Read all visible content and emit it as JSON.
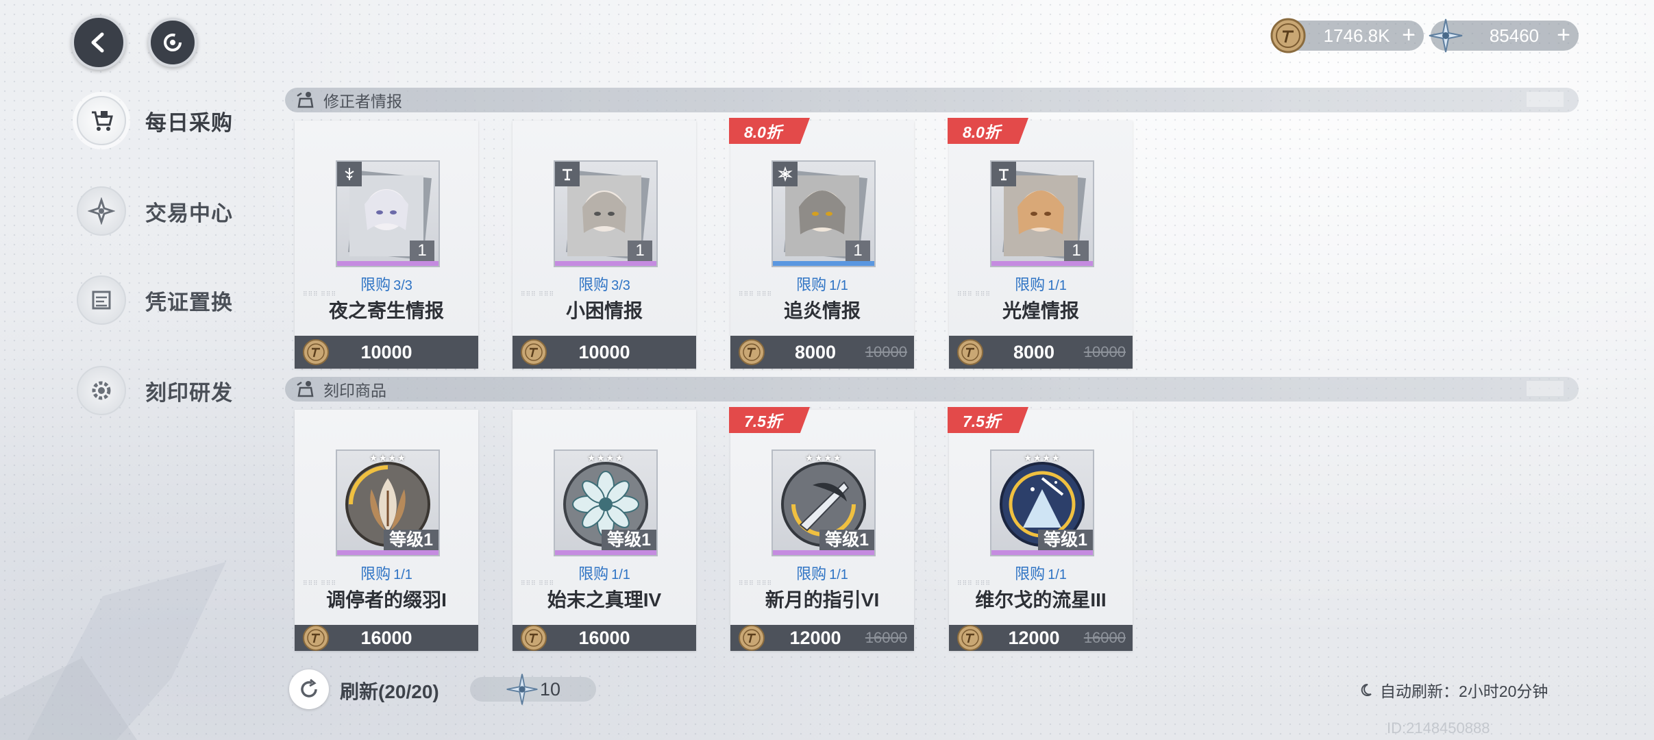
{
  "currency": [
    {
      "icon": "gold-coin-icon",
      "value": "1746.8K",
      "plus": "+"
    },
    {
      "icon": "star-crystal-icon",
      "value": "85460",
      "plus": "+"
    }
  ],
  "sidebar": {
    "items": [
      {
        "label": "每日采购",
        "icon": "cart-icon",
        "active": true
      },
      {
        "label": "交易中心",
        "icon": "star-badge-icon",
        "active": false
      },
      {
        "label": "凭证置换",
        "icon": "exchange-icon",
        "active": false
      },
      {
        "label": "刻印研发",
        "icon": "gear-icon",
        "active": false
      }
    ]
  },
  "sections": [
    {
      "title": "修正者情报",
      "items": [
        {
          "discount": "",
          "limit_label": "限购",
          "limit": "3/3",
          "name": "夜之寄生情报",
          "qty": "1",
          "price": "10000",
          "old_price": "",
          "rarity_color": "#c58be0"
        },
        {
          "discount": "",
          "limit_label": "限购",
          "limit": "3/3",
          "name": "小困情报",
          "qty": "1",
          "price": "10000",
          "old_price": "",
          "rarity_color": "#c58be0"
        },
        {
          "discount": "8.0折",
          "limit_label": "限购",
          "limit": "1/1",
          "name": "追炎情报",
          "qty": "1",
          "price": "8000",
          "old_price": "10000",
          "rarity_color": "#5a97e0"
        },
        {
          "discount": "8.0折",
          "limit_label": "限购",
          "limit": "1/1",
          "name": "光煌情报",
          "qty": "1",
          "price": "8000",
          "old_price": "10000",
          "rarity_color": "#c58be0"
        }
      ]
    },
    {
      "title": "刻印商品",
      "items": [
        {
          "discount": "",
          "limit_label": "限购",
          "limit": "1/1",
          "name": "调停者的缀羽I",
          "level": "等级1",
          "stars": "★★★★",
          "price": "16000",
          "old_price": "",
          "rarity_color": "#c58be0"
        },
        {
          "discount": "",
          "limit_label": "限购",
          "limit": "1/1",
          "name": "始末之真理IV",
          "level": "等级1",
          "stars": "★★★★",
          "price": "16000",
          "old_price": "",
          "rarity_color": "#c58be0"
        },
        {
          "discount": "7.5折",
          "limit_label": "限购",
          "limit": "1/1",
          "name": "新月的指引VI",
          "level": "等级1",
          "stars": "★★★★",
          "price": "12000",
          "old_price": "16000",
          "rarity_color": "#c58be0"
        },
        {
          "discount": "7.5折",
          "limit_label": "限购",
          "limit": "1/1",
          "name": "维尔戈的流星III",
          "level": "等级1",
          "stars": "★★★★",
          "price": "12000",
          "old_price": "16000",
          "rarity_color": "#c58be0"
        }
      ]
    }
  ],
  "bottom": {
    "refresh_label": "刷新(20/20)",
    "refresh_cost": "10",
    "auto_refresh": "自动刷新：2小时20分钟",
    "uid": "ID:2148450888"
  },
  "colors": {
    "discount": "#e34a4a",
    "limit": "#2e73c4",
    "price_bar": "#4d525b"
  }
}
